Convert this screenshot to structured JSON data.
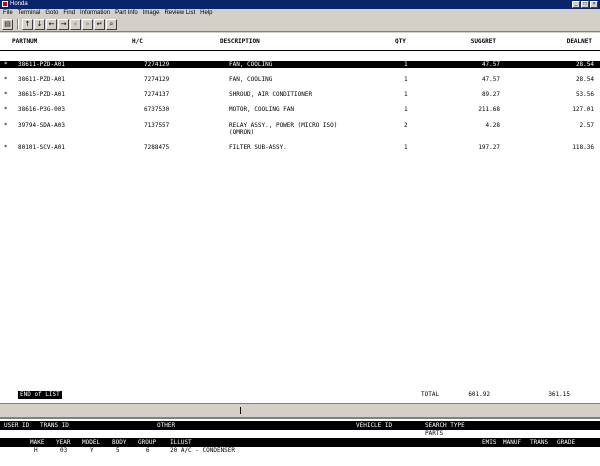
{
  "window": {
    "title": "Honda"
  },
  "menu": [
    "File",
    "Terminal",
    "Goto",
    "Find",
    "Information",
    "Part Info",
    "Image",
    "Review List",
    "Help"
  ],
  "toolbar": {
    "buttons": [
      "printer-icon",
      "up-arrow-icon",
      "down-arrow-icon",
      "left-arrow-icon",
      "right-arrow-icon",
      "first-page-icon",
      "last-page-icon",
      "enter-icon",
      "magnifier-icon"
    ]
  },
  "table": {
    "headers": {
      "partnum": "PARTNUM",
      "hc": "H/C",
      "description": "DESCRIPTION",
      "qty": "QTY",
      "suggret": "SUGGRET",
      "dealnet": "DEALNET"
    },
    "rows": [
      {
        "mark": "*",
        "partnum": "38611-PZD-A01",
        "hc": "7274129",
        "description": "FAN, COOLING",
        "qty": "1",
        "suggret": "47.57",
        "dealnet": "28.54"
      },
      {
        "mark": "*",
        "partnum": "38611-PZD-A01",
        "hc": "7274129",
        "description": "FAN, COOLING",
        "qty": "1",
        "suggret": "47.57",
        "dealnet": "28.54"
      },
      {
        "mark": "*",
        "partnum": "38615-PZD-A01",
        "hc": "7274137",
        "description": "SHROUD, AIR CONDITIONER",
        "qty": "1",
        "suggret": "89.27",
        "dealnet": "53.56"
      },
      {
        "mark": "*",
        "partnum": "38616-P3G-003",
        "hc": "6737530",
        "description": "MOTOR, COOLING FAN",
        "qty": "1",
        "suggret": "211.68",
        "dealnet": "127.01"
      },
      {
        "mark": "*",
        "partnum": "39794-SDA-A03",
        "hc": "7137557",
        "description": "RELAY ASSY., POWER (MICRO ISO)",
        "description2": "(OMRON)",
        "qty": "2",
        "suggret": "4.28",
        "dealnet": "2.57"
      },
      {
        "mark": "*",
        "partnum": "80101-SCV-A01",
        "hc": "7288475",
        "description": "FILTER SUB-ASSY.",
        "qty": "1",
        "suggret": "197.27",
        "dealnet": "118.36"
      }
    ],
    "selected_row": 0
  },
  "footer": {
    "end_of_list": "END of LIST",
    "total_label": "TOTAL",
    "total_suggret": "601.92",
    "total_dealnet": "361.15"
  },
  "status": {
    "bar1": {
      "user_id": "USER ID",
      "trans_id": "TRANS ID",
      "other": "OTHER",
      "vehicle_id": "VEHICLE ID",
      "search_type": "SEARCH TYPE"
    },
    "search_type_value": "PARTS",
    "bar2": {
      "make": "MAKE",
      "year": "YEAR",
      "model": "MODEL",
      "body": "BODY",
      "group": "GROUP",
      "illust": "ILLUST",
      "emis": "EMIS",
      "manuf": "MANUF",
      "trans": "TRANS",
      "grade": "GRADE"
    },
    "values": {
      "make": "H",
      "year": "03",
      "model": "Y",
      "body": "5",
      "group": "6",
      "illust": "20 A/C - CONDENSER"
    }
  }
}
